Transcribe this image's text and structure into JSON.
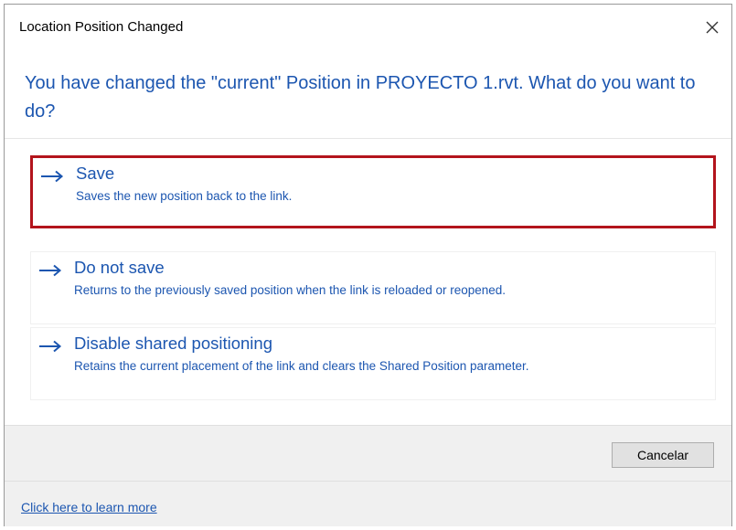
{
  "dialog": {
    "title": "Location Position Changed",
    "close_icon": "close-icon",
    "instruction": "You have changed the \"current\" Position in PROYECTO 1.rvt.  What do you want to do?"
  },
  "commands": [
    {
      "label": "Save",
      "description": "Saves the new position back to the link.",
      "icon": "arrow-right-icon",
      "highlighted": true
    },
    {
      "label": "Do not save",
      "description": "Returns to the previously saved position when the link is reloaded or reopened.",
      "icon": "arrow-right-icon",
      "highlighted": false
    },
    {
      "label": "Disable shared positioning",
      "description": "Retains the current placement of the link and clears the Shared Position parameter.",
      "icon": "arrow-right-icon",
      "highlighted": false
    }
  ],
  "footer": {
    "cancel_label": "Cancelar",
    "learn_more_link": "Click here to learn more"
  },
  "colors": {
    "link_blue": "#1c56b0",
    "highlight_border": "#b3141c",
    "footer_bg": "#f0f0f0"
  }
}
